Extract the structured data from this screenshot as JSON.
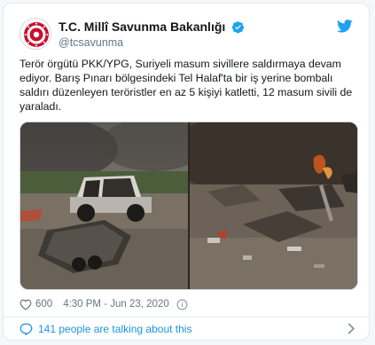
{
  "tweet": {
    "author": {
      "display_name": "T.C. Millî Savunma Bakanlığı",
      "handle": "@tcsavunma",
      "verified": true,
      "avatar_icon": "ministry-emblem-icon"
    },
    "brand_icon": "twitter-bird-icon",
    "text": "Terör örgütü PKK/YPG, Suriyeli masum sivillere saldırmaya devam\nediyor. Barış Pınarı bölgesindeki Tel Halaf'ta bir iş yerine bombalı\nsaldırı düzenleyen teröristler en az 5 kişiyi katletti, 12 masum sivili de\nyaraladı.",
    "media": [
      {
        "kind": "photo",
        "icon": "burnt-car-photo"
      },
      {
        "kind": "photo",
        "icon": "rubble-debris-photo"
      }
    ],
    "likes": "600",
    "timestamp": "4:30 PM - Jun 23, 2020",
    "talking_about": "141 people are talking about this"
  },
  "colors": {
    "accent": "#1da1f2",
    "link": "#1b95e0",
    "like": "#e0245e",
    "muted": "#657786",
    "emblem_red": "#c8102e"
  }
}
